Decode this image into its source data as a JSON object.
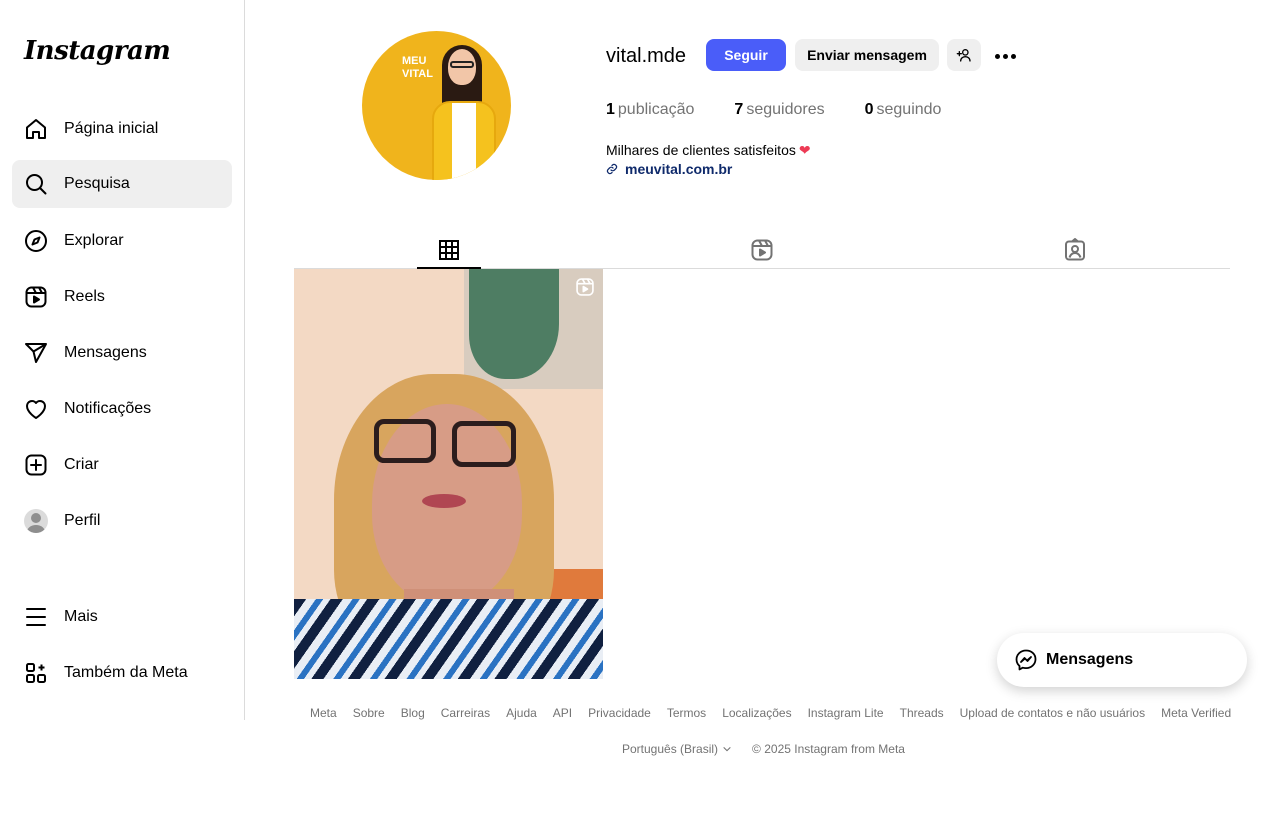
{
  "app": {
    "logo": "Instagram"
  },
  "sidebar": {
    "items": [
      {
        "label": "Página inicial",
        "icon": "home-icon"
      },
      {
        "label": "Pesquisa",
        "icon": "search-icon"
      },
      {
        "label": "Explorar",
        "icon": "compass-icon"
      },
      {
        "label": "Reels",
        "icon": "reels-icon"
      },
      {
        "label": "Mensagens",
        "icon": "send-icon"
      },
      {
        "label": "Notificações",
        "icon": "heart-icon"
      },
      {
        "label": "Criar",
        "icon": "plus-square-icon"
      },
      {
        "label": "Perfil",
        "icon": "avatar"
      }
    ],
    "more": {
      "label": "Mais",
      "icon": "menu-icon"
    },
    "meta": {
      "label": "Também da Meta",
      "icon": "apps-icon"
    }
  },
  "profile": {
    "username": "vital.mde",
    "picture_text": "MEU VITAL",
    "follow_label": "Seguir",
    "message_label": "Enviar mensagem",
    "stats": {
      "posts_count": "1",
      "posts_label": "publicação",
      "followers_count": "7",
      "followers_label": "seguidores",
      "following_count": "0",
      "following_label": "seguindo"
    },
    "bio": "Milhares de clientes satisfeitos",
    "bio_emoji": "❤",
    "link": "meuvital.com.br"
  },
  "tabs": [
    {
      "icon": "grid-icon",
      "active": true
    },
    {
      "icon": "reels-icon",
      "active": false
    },
    {
      "icon": "tagged-icon",
      "active": false
    }
  ],
  "footer": {
    "links": [
      "Meta",
      "Sobre",
      "Blog",
      "Carreiras",
      "Ajuda",
      "API",
      "Privacidade",
      "Termos",
      "Localizações",
      "Instagram Lite",
      "Threads",
      "Upload de contatos e não usuários",
      "Meta Verified"
    ],
    "language": "Português (Brasil)",
    "copyright": "© 2025 Instagram from Meta"
  },
  "floating_messages": {
    "label": "Mensagens"
  },
  "colors": {
    "accent": "#4a5df9",
    "muted": "#737373",
    "link": "#0f2a6b"
  }
}
